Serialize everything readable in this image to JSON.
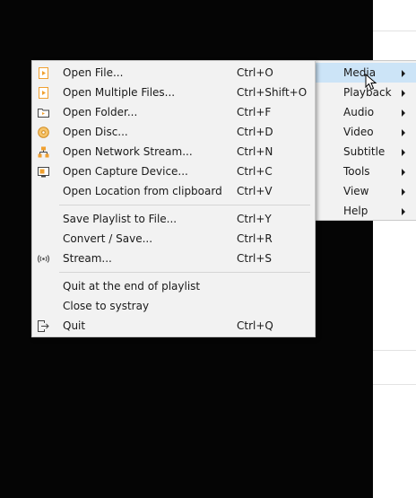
{
  "parent_menu": {
    "items": [
      {
        "label": "Media",
        "has_submenu": true,
        "active": true
      },
      {
        "label": "Playback",
        "has_submenu": true
      },
      {
        "label": "Audio",
        "has_submenu": true
      },
      {
        "label": "Video",
        "has_submenu": true
      },
      {
        "label": "Subtitle",
        "has_submenu": true
      },
      {
        "label": "Tools",
        "has_submenu": true
      },
      {
        "label": "View",
        "has_submenu": true
      },
      {
        "label": "Help",
        "has_submenu": true
      }
    ]
  },
  "media_menu": {
    "items": [
      {
        "label": "Open File...",
        "shortcut": "Ctrl+O",
        "icon": "play-file-icon"
      },
      {
        "label": "Open Multiple Files...",
        "shortcut": "Ctrl+Shift+O",
        "icon": "play-file-icon"
      },
      {
        "label": "Open Folder...",
        "shortcut": "Ctrl+F",
        "icon": "folder-icon"
      },
      {
        "label": "Open Disc...",
        "shortcut": "Ctrl+D",
        "icon": "disc-icon"
      },
      {
        "label": "Open Network Stream...",
        "shortcut": "Ctrl+N",
        "icon": "network-icon"
      },
      {
        "label": "Open Capture Device...",
        "shortcut": "Ctrl+C",
        "icon": "capture-device-icon"
      },
      {
        "label": "Open Location from clipboard",
        "shortcut": "Ctrl+V",
        "icon": ""
      },
      {
        "label": "Save Playlist to File...",
        "shortcut": "Ctrl+Y",
        "icon": ""
      },
      {
        "label": "Convert / Save...",
        "shortcut": "Ctrl+R",
        "icon": ""
      },
      {
        "label": "Stream...",
        "shortcut": "Ctrl+S",
        "icon": "stream-icon"
      },
      {
        "label": "Quit at the end of playlist",
        "shortcut": "",
        "icon": ""
      },
      {
        "label": "Close to systray",
        "shortcut": "",
        "icon": ""
      },
      {
        "label": "Quit",
        "shortcut": "Ctrl+Q",
        "icon": "quit-icon"
      }
    ]
  },
  "colors": {
    "menu_bg": "#f2f2f2",
    "active_bg": "#cce4f7",
    "accent_orange": "#f0a030",
    "background": "#000000"
  }
}
